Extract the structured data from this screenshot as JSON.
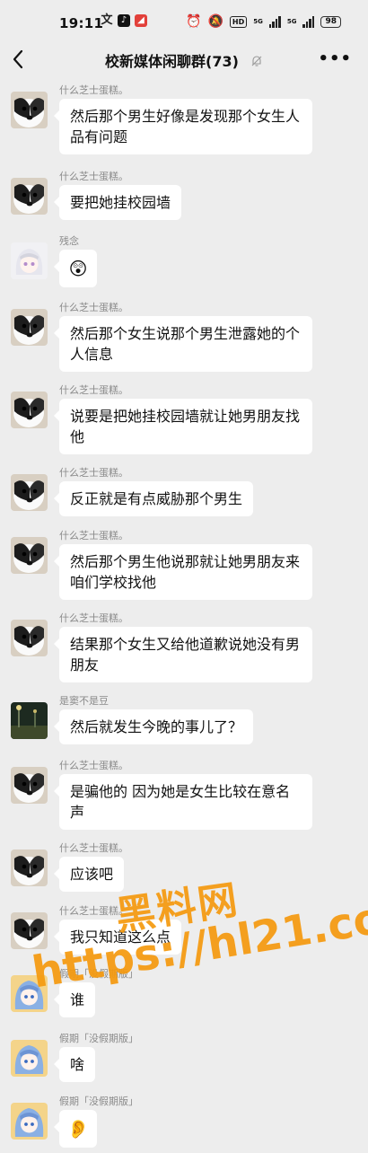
{
  "status_bar": {
    "time": "19:11",
    "network_label": "HD",
    "signal_label_1": "5G",
    "signal_label_2": "5G",
    "battery": "98"
  },
  "header": {
    "back_icon": "chevron-left-icon",
    "title": "校新媒体闲聊群(73)",
    "mute_icon": "bell-off-icon",
    "more_icon": "more-dots-icon"
  },
  "messages": [
    {
      "sender": "什么芝士蛋糕。",
      "text": "然后那个男生好像是发现那个女生人品有问题",
      "avatar": "dog"
    },
    {
      "sender": "什么芝士蛋糕。",
      "text": "要把她挂校园墙",
      "avatar": "dog"
    },
    {
      "sender": "残念",
      "text": "",
      "emoji": "😲",
      "avatar": "anime-white"
    },
    {
      "sender": "什么芝士蛋糕。",
      "text": "然后那个女生说那个男生泄露她的个人信息",
      "avatar": "dog"
    },
    {
      "sender": "什么芝士蛋糕。",
      "text": "说要是把她挂校园墙就让她男朋友找他",
      "avatar": "dog"
    },
    {
      "sender": "什么芝士蛋糕。",
      "text": "反正就是有点威胁那个男生",
      "avatar": "dog"
    },
    {
      "sender": "什么芝士蛋糕。",
      "text": "然后那个男生他说那就让她男朋友来咱们学校找他",
      "avatar": "dog"
    },
    {
      "sender": "什么芝士蛋糕。",
      "text": "结果那个女生又给他道歉说她没有男朋友",
      "avatar": "dog"
    },
    {
      "sender": "是窦不是豆",
      "text": "然后就发生今晚的事儿了？",
      "avatar": "night"
    },
    {
      "sender": "什么芝士蛋糕。",
      "text": "是骗他的 因为她是女生比较在意名声",
      "avatar": "dog"
    },
    {
      "sender": "什么芝士蛋糕。",
      "text": "应该吧",
      "avatar": "dog"
    },
    {
      "sender": "什么芝士蛋糕。",
      "text": "我只知道这么点",
      "avatar": "dog"
    },
    {
      "sender": "假期「没假期版」",
      "text": "谁",
      "avatar": "anime-blue"
    },
    {
      "sender": "假期「没假期版」",
      "text": "啥",
      "avatar": "anime-blue"
    },
    {
      "sender": "假期「没假期版」",
      "text": "",
      "emoji": "👂",
      "avatar": "anime-blue"
    }
  ],
  "watermark": {
    "line1": "黑料网",
    "line2": "https://hl21.co"
  }
}
